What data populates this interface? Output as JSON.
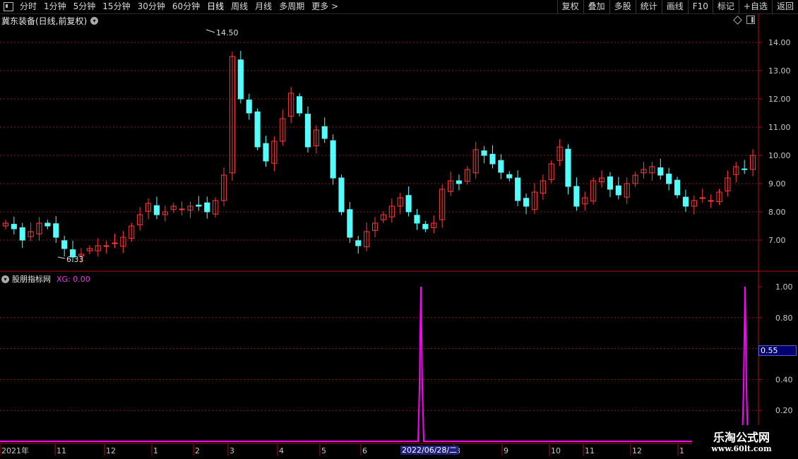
{
  "toolbar": {
    "periods": [
      "分时",
      "1分钟",
      "5分钟",
      "15分钟",
      "30分钟",
      "60分钟",
      "日线",
      "周线",
      "月线",
      "多周期",
      "更多 >"
    ],
    "active_period": "日线",
    "actions": [
      "复权",
      "叠加",
      "多股",
      "统计",
      "画线",
      "F10",
      "标记",
      "+自选",
      "返回"
    ]
  },
  "chart": {
    "stock_title": "冀东装备(日线,前复权)",
    "price_axis_labels": [
      "14.00",
      "13.00",
      "12.00",
      "11.00",
      "10.00",
      "9.00",
      "8.00",
      "7.00"
    ],
    "high_label": "14.50",
    "low_label": "6.33",
    "indicator_name": "股朋指标网",
    "indicator_value_label": "XG: 0.00",
    "indicator_axis_labels": [
      "1.00",
      "0.80",
      "0.40",
      "0.20"
    ],
    "cursor_value": "0.55",
    "date_axis_labels": [
      "2021年",
      "11",
      "12",
      "1",
      "2",
      "3",
      "4",
      "5",
      "6",
      "8",
      "9",
      "10",
      "11",
      "12",
      "1",
      "1"
    ],
    "date_cursor": "2022/06/28/二"
  },
  "colors": {
    "up": "#ff3b3b",
    "down": "#54fcfc",
    "indicator": "#ff00ff",
    "grid": "#8b1a1a",
    "axis": "#b01010"
  },
  "watermark": {
    "title": "乐淘公式网",
    "url": "www.60lt.com"
  },
  "chart_data": {
    "type": "candlestick",
    "price_ylim": [
      6.0,
      14.8
    ],
    "price_close_series": [
      7.6,
      7.4,
      7.0,
      7.3,
      7.6,
      7.5,
      7.1,
      6.7,
      6.4,
      6.5,
      6.7,
      6.8,
      6.8,
      6.9,
      7.1,
      7.5,
      7.9,
      8.3,
      7.9,
      8.0,
      8.2,
      8.1,
      8.2,
      8.2,
      8.0,
      8.4,
      9.3,
      13.5,
      12.0,
      11.5,
      10.3,
      9.8,
      10.5,
      11.3,
      12.2,
      11.5,
      10.3,
      10.9,
      10.6,
      9.2,
      8.0,
      7.1,
      6.8,
      7.3,
      7.6,
      7.9,
      8.2,
      8.5,
      8.0,
      7.6,
      7.4,
      7.6,
      8.8,
      9.1,
      9.0,
      9.5,
      10.2,
      10.0,
      9.7,
      9.4,
      9.2,
      8.4,
      8.2,
      8.7,
      9.1,
      9.7,
      10.3,
      8.9,
      8.2,
      8.5,
      9.1,
      9.2,
      8.8,
      8.6,
      9.0,
      9.3,
      9.5,
      9.6,
      9.3,
      9.0,
      8.6,
      8.2,
      8.4,
      8.5,
      8.4,
      8.7,
      9.2,
      9.6,
      9.5,
      10.0
    ],
    "indicator": {
      "name": "XG",
      "current": 0.0,
      "ylim": [
        0,
        1.05
      ],
      "signals": [
        {
          "date": "2022/06/28",
          "value": 1.0
        },
        {
          "date": "latest",
          "value": 1.0
        }
      ]
    }
  }
}
